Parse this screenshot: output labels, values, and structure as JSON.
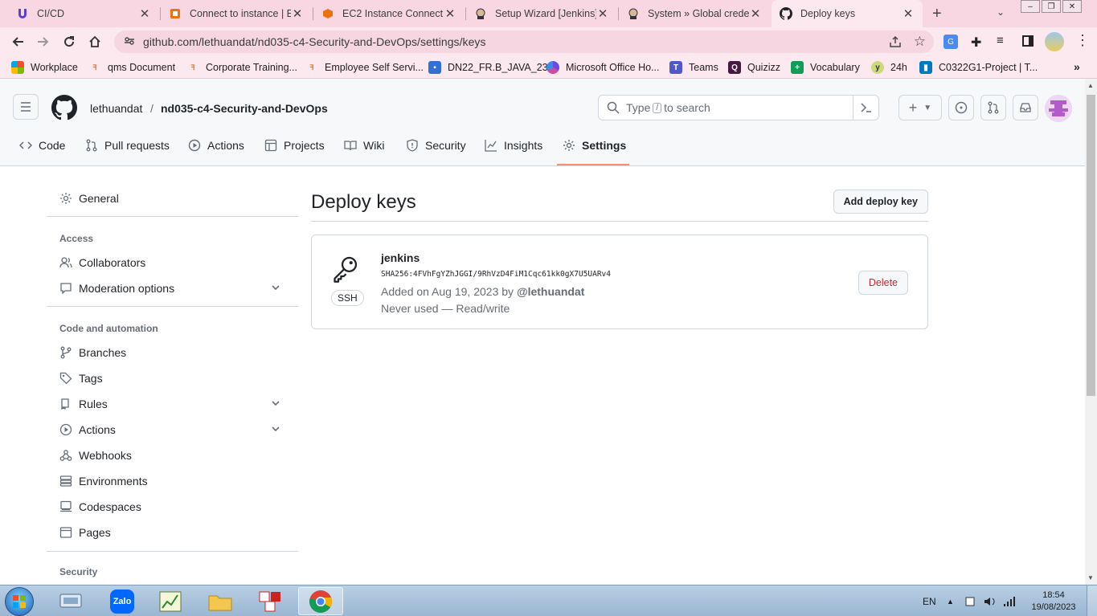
{
  "browser": {
    "tabs": [
      {
        "title": "CI/CD",
        "icon": "udacity-icon"
      },
      {
        "title": "Connect to instance | EC",
        "icon": "aws-icon"
      },
      {
        "title": "EC2 Instance Connect",
        "icon": "aws-cube-icon"
      },
      {
        "title": "Setup Wizard [Jenkins]",
        "icon": "jenkins-icon"
      },
      {
        "title": "System » Global creden",
        "icon": "jenkins-icon"
      },
      {
        "title": "Deploy keys",
        "icon": "github-icon",
        "active": true
      }
    ],
    "url": "github.com/lethuandat/nd035-c4-Security-and-DevOps/settings/keys",
    "bookmarks": [
      "Workplace",
      "qms Document",
      "Corporate Training...",
      "Employee Self Servi...",
      "DN22_FR.B_JAVA_23",
      "Microsoft Office Ho...",
      "Teams",
      "Quizizz",
      "Vocabulary",
      "24h",
      "C0322G1-Project | T..."
    ]
  },
  "github": {
    "owner": "lethuandat",
    "separator": "/",
    "repo": "nd035-c4-Security-and-DevOps",
    "search_prefix": "Type",
    "search_key": "/",
    "search_suffix": "to search",
    "repo_nav": [
      "Code",
      "Pull requests",
      "Actions",
      "Projects",
      "Wiki",
      "Security",
      "Insights",
      "Settings"
    ],
    "active_nav": "Settings"
  },
  "sidebar": {
    "general": "General",
    "access_heading": "Access",
    "collaborators": "Collaborators",
    "moderation": "Moderation options",
    "code_heading": "Code and automation",
    "branches": "Branches",
    "tags": "Tags",
    "rules": "Rules",
    "actions": "Actions",
    "webhooks": "Webhooks",
    "environments": "Environments",
    "codespaces": "Codespaces",
    "pages": "Pages",
    "security_heading": "Security"
  },
  "main": {
    "title": "Deploy keys",
    "add_button": "Add deploy key",
    "key": {
      "name": "jenkins",
      "type": "SSH",
      "fingerprint": "SHA256:4FVhFgYZhJGGI/9RhVzD4FiM1Cqc61kk0gX7U5UARv4",
      "added_prefix": "Added on Aug 19, 2023 by",
      "added_by": "@lethuandat",
      "usage": "Never used — Read/write",
      "delete": "Delete"
    }
  },
  "taskbar": {
    "lang": "EN",
    "time": "18:54",
    "date": "19/08/2023"
  },
  "colors": {
    "tabstrip": "#f8d7e2",
    "toolbar": "#fce9ef",
    "accent_underline": "#fd8c73",
    "danger": "#cf222e"
  }
}
